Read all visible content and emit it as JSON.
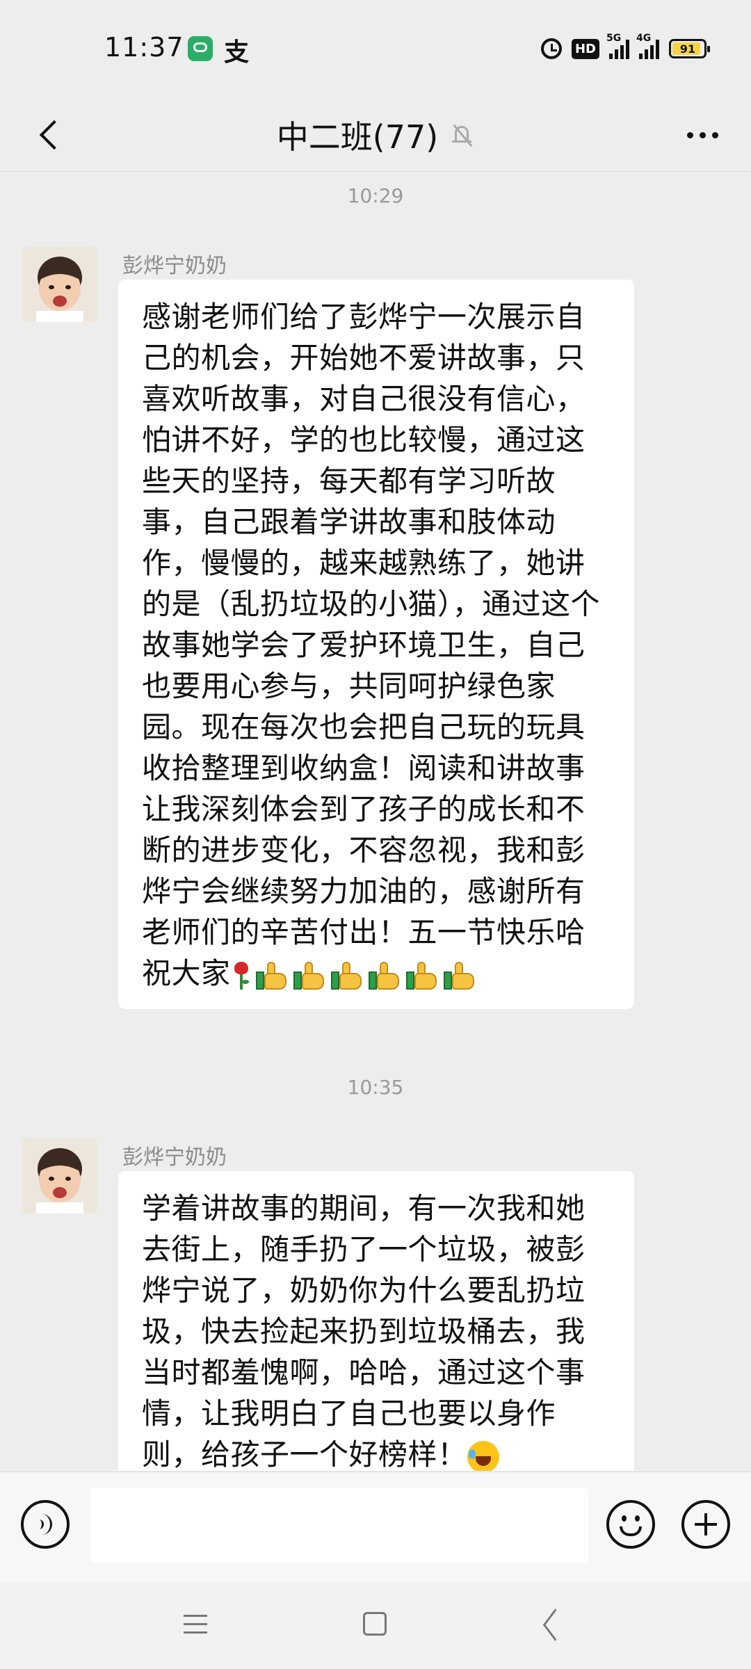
{
  "status_bar": {
    "time": "11:37",
    "pay_icon": "支",
    "hd_badge": "HD",
    "signal1_label": "5G",
    "signal2_label": "4G",
    "battery": "91",
    "battery_level": 0.91,
    "battery_color": "#f4d54a"
  },
  "header": {
    "title": "中二班(77)",
    "back_icon": "chevron-left-icon",
    "mute_icon": "bell-off-icon",
    "more_icon": "more-horizontal-icon"
  },
  "messages": [
    {
      "timestamp": "10:29",
      "sender": "彭烨宁奶奶",
      "text": "感谢老师们给了彭烨宁一次展示自己的机会，开始她不爱讲故事，只喜欢听故事，对自己很没有信心，怕讲不好，学的也比较慢，通过这些天的坚持，每天都有学习听故事，自己跟着学讲故事和肢体动作，慢慢的，越来越熟练了，她讲的是（乱扔垃圾的小猫），通过这个故事她学会了爱护环境卫生，自己也要用心参与，共同呵护绿色家园。现在每次也会把自己玩的玩具收拾整理到收纳盒！阅读和讲故事让我深刻体会到了孩子的成长和不断的进步变化，不容忽视，我和彭烨宁会继续努力加油的，感谢所有老师们的辛苦付出！五一节快乐哈祝大家",
      "emojis": [
        "rose",
        "thumbs-up",
        "thumbs-up",
        "thumbs-up",
        "thumbs-up",
        "thumbs-up",
        "thumbs-up"
      ]
    },
    {
      "timestamp": "10:35",
      "sender": "彭烨宁奶奶",
      "text": "学着讲故事的期间，有一次我和她去街上，随手扔了一个垃圾，被彭烨宁说了，奶奶你为什么要乱扔垃圾，快去捡起来扔到垃圾桶去，我当时都羞愧啊，哈哈，通过这个事情，让我明白了自己也要以身作则，给孩子一个好榜样！",
      "emojis": [
        "laughing-crying"
      ]
    }
  ],
  "input_bar": {
    "voice_icon": "voice-icon",
    "text_value": "",
    "emoji_icon": "smiley-icon",
    "plus_icon": "plus-circle-icon"
  },
  "system_nav": {
    "menu_icon": "menu-icon",
    "home_icon": "home-square-icon",
    "back_icon": "back-triangle-icon"
  },
  "colors": {
    "background": "#ededed",
    "bubble": "#ffffff",
    "timestamp": "#999999",
    "sender": "#8c8c8c",
    "wechat_green": "#2aae67"
  }
}
